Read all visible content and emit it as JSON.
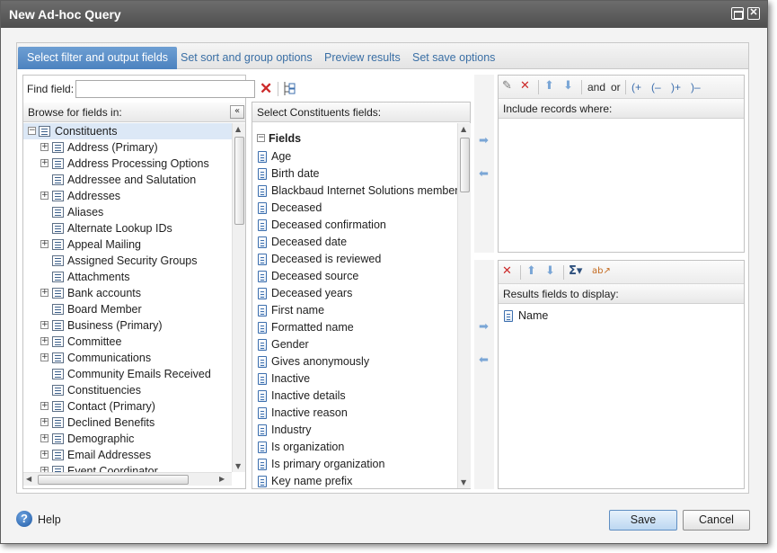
{
  "window": {
    "title": "New Ad-hoc Query"
  },
  "tabs": [
    {
      "label": "Select filter and output fields",
      "active": true
    },
    {
      "label": "Set sort and group options",
      "active": false
    },
    {
      "label": "Preview results",
      "active": false
    },
    {
      "label": "Set save options",
      "active": false
    }
  ],
  "left_panel": {
    "find_label": "Find field:",
    "find_value": "",
    "browse_header": "Browse for fields in:",
    "root": "Constituents",
    "items": [
      {
        "label": "Address (Primary)",
        "expandable": true
      },
      {
        "label": "Address Processing Options",
        "expandable": true
      },
      {
        "label": "Addressee and Salutation",
        "expandable": false
      },
      {
        "label": "Addresses",
        "expandable": true
      },
      {
        "label": "Aliases",
        "expandable": false
      },
      {
        "label": "Alternate Lookup IDs",
        "expandable": false
      },
      {
        "label": "Appeal Mailing",
        "expandable": true
      },
      {
        "label": "Assigned Security Groups",
        "expandable": false
      },
      {
        "label": "Attachments",
        "expandable": false
      },
      {
        "label": "Bank accounts",
        "expandable": true
      },
      {
        "label": "Board Member",
        "expandable": false
      },
      {
        "label": "Business (Primary)",
        "expandable": true
      },
      {
        "label": "Committee",
        "expandable": true
      },
      {
        "label": "Communications",
        "expandable": true
      },
      {
        "label": "Community Emails Received",
        "expandable": false
      },
      {
        "label": "Constituencies",
        "expandable": false
      },
      {
        "label": "Contact (Primary)",
        "expandable": true
      },
      {
        "label": "Declined Benefits",
        "expandable": true
      },
      {
        "label": "Demographic",
        "expandable": true
      },
      {
        "label": "Email Addresses",
        "expandable": true
      },
      {
        "label": "Event Coordinator",
        "expandable": true
      }
    ]
  },
  "middle_panel": {
    "header": "Select Constituents fields:",
    "group_label": "Fields",
    "fields": [
      "Age",
      "Birth date",
      "Blackbaud Internet Solutions member",
      "Deceased",
      "Deceased confirmation",
      "Deceased date",
      "Deceased is reviewed",
      "Deceased source",
      "Deceased years",
      "First name",
      "Formatted name",
      "Gender",
      "Gives anonymously",
      "Inactive",
      "Inactive details",
      "Inactive reason",
      "Industry",
      "Is organization",
      "Is primary organization",
      "Key name prefix"
    ]
  },
  "filter_panel": {
    "and_label": "and",
    "or_label": "or",
    "open_paren_label": "(+",
    "remove_paren_label": "(–",
    "close_paren_label": ")+",
    "remove_close_paren_label": ")–",
    "header": "Include records where:"
  },
  "output_panel": {
    "header": "Results fields to display:",
    "fields": [
      "Name"
    ]
  },
  "footer": {
    "help_label": "Help",
    "save_label": "Save",
    "cancel_label": "Cancel"
  },
  "colors": {
    "accent": "#4c82bf",
    "delete_red": "#cc2a2a",
    "arrow_blue": "#7aa6d6"
  }
}
